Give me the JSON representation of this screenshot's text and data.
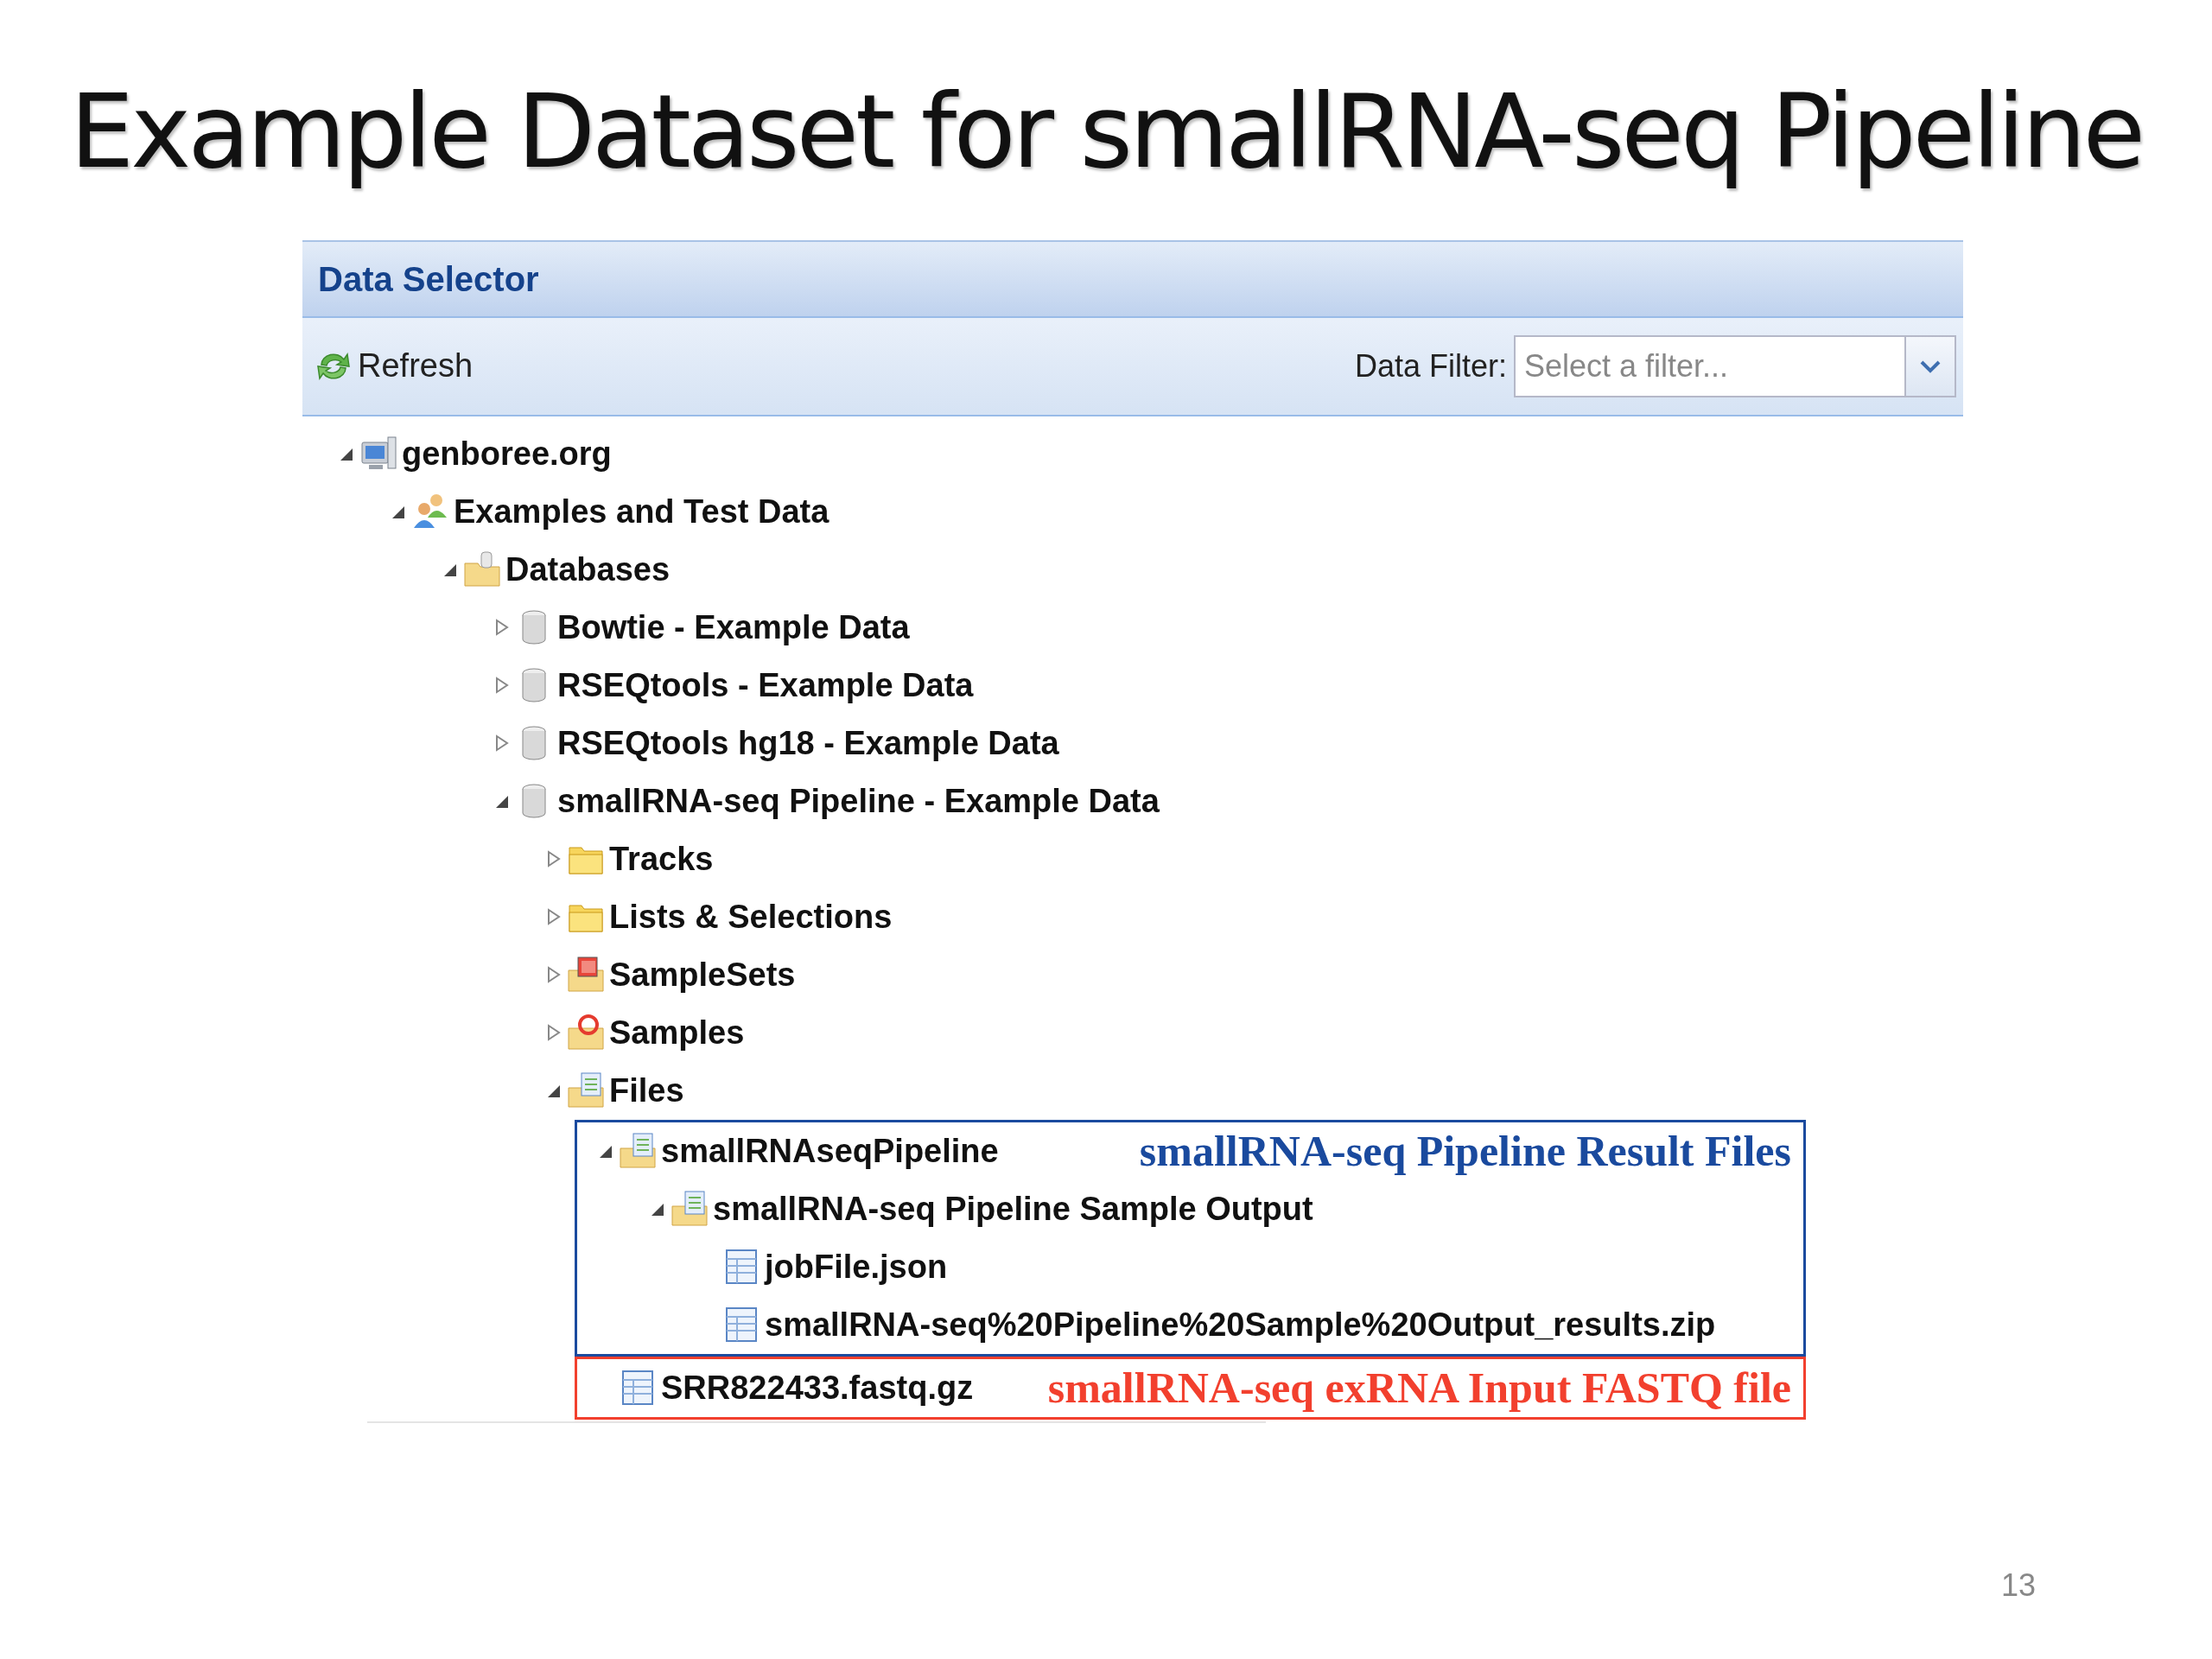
{
  "slide_title": "Example Dataset for smallRNA-seq Pipeline",
  "panel": {
    "title": "Data Selector",
    "toolbar": {
      "refresh_label": "Refresh",
      "filter_label": "Data Filter:",
      "filter_placeholder": "Select a filter..."
    }
  },
  "tree": [
    {
      "label": "genboree.org",
      "kind": "server",
      "expanded": true,
      "children": [
        {
          "label": "Examples and Test Data",
          "kind": "group",
          "expanded": true,
          "children": [
            {
              "label": "Databases",
              "kind": "db-folder",
              "expanded": true,
              "children": [
                {
                  "label": "Bowtie - Example Data",
                  "kind": "database",
                  "expanded": false
                },
                {
                  "label": "RSEQtools - Example Data",
                  "kind": "database",
                  "expanded": false
                },
                {
                  "label": "RSEQtools hg18 - Example Data",
                  "kind": "database",
                  "expanded": false
                },
                {
                  "label": "smallRNA-seq Pipeline - Example Data",
                  "kind": "database",
                  "expanded": true,
                  "children": [
                    {
                      "label": "Tracks",
                      "kind": "folder",
                      "expanded": false
                    },
                    {
                      "label": "Lists & Selections",
                      "kind": "folder",
                      "expanded": false
                    },
                    {
                      "label": "SampleSets",
                      "kind": "sampleset-folder",
                      "expanded": false
                    },
                    {
                      "label": "Samples",
                      "kind": "samples-folder",
                      "expanded": false
                    },
                    {
                      "label": "Files",
                      "kind": "files-folder",
                      "expanded": true,
                      "children": [
                        {
                          "label": "smallRNAseqPipeline",
                          "kind": "files-folder",
                          "expanded": true,
                          "annotation": {
                            "text": "smallRNA-seq Pipeline Result Files",
                            "color": "#1a4a9e"
                          },
                          "children": [
                            {
                              "label": "smallRNA-seq Pipeline Sample Output",
                              "kind": "files-folder",
                              "expanded": true,
                              "children": [
                                {
                                  "label": "jobFile.json",
                                  "kind": "file"
                                },
                                {
                                  "label": "smallRNA-seq%20Pipeline%20Sample%20Output_results.zip",
                                  "kind": "file"
                                }
                              ]
                            }
                          ]
                        },
                        {
                          "label": "SRR822433.fastq.gz",
                          "kind": "file",
                          "annotation": {
                            "text": "smallRNA-seq exRNA Input FASTQ file",
                            "color": "#f2402e"
                          }
                        }
                      ]
                    }
                  ]
                }
              ]
            }
          ]
        }
      ]
    }
  ],
  "page_number": "13"
}
